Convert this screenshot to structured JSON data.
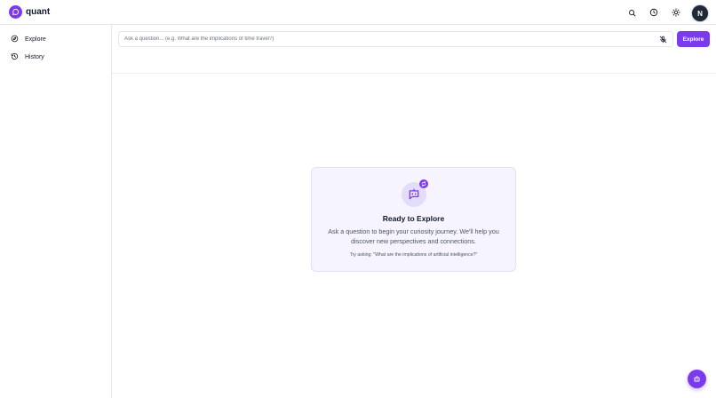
{
  "app": {
    "name": "quant"
  },
  "colors": {
    "accent": "#7c3aed",
    "border": "#e5e7eb",
    "card_bg": "#f6f4fe"
  },
  "header": {
    "icons": [
      "search-icon",
      "history-icon",
      "theme-icon"
    ],
    "avatar_initial": "N"
  },
  "sidebar": {
    "items": [
      {
        "label": "Explore",
        "icon": "compass-icon"
      },
      {
        "label": "History",
        "icon": "history-icon"
      }
    ]
  },
  "search": {
    "placeholder": "Ask a question... (e.g. What are the implications of time travel?)",
    "value": "",
    "mic_icon": "mic-off-icon",
    "button_label": "Explore"
  },
  "empty_state": {
    "icon": "bot-chat-icon",
    "badge_icon": "refresh-icon",
    "title": "Ready to Explore",
    "description": "Ask a question to begin your curiosity journey. We'll help you discover new perspectives and connections.",
    "hint": "Try asking: \"What are the implications of artificial intelligence?\""
  },
  "fab": {
    "icon": "bot-icon"
  }
}
